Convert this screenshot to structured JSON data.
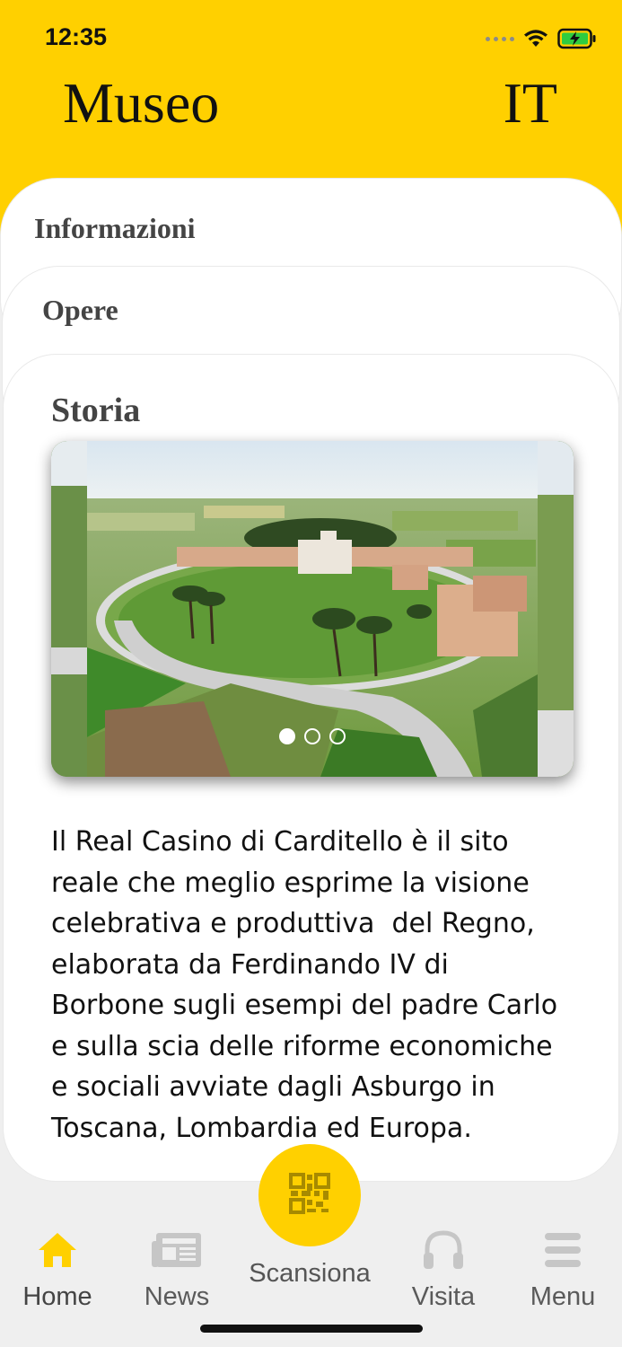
{
  "status_bar": {
    "time": "12:35"
  },
  "header": {
    "title": "Museo",
    "language": "IT"
  },
  "sections": {
    "info_title": "Informazioni",
    "opere_title": "Opere",
    "storia_title": "Storia"
  },
  "carousel": {
    "slide_count": 3,
    "active_index": 0
  },
  "story": {
    "text": "Il Real Casino di Carditello è il sito\nreale che meglio esprime la visione\ncelebrativa e produttiva  del Regno,\nelaborata da Ferdinando IV di\nBorbone sugli esempi del padre Carlo\ne sulla scia delle riforme economiche\ne sociali avviate dagli Asburgo in\nToscana, Lombardia ed Europa."
  },
  "tabbar": {
    "home": "Home",
    "news": "News",
    "scan": "Scansiona",
    "visita": "Visita",
    "menu": "Menu"
  },
  "colors": {
    "accent": "#ffd000",
    "background": "#efefef"
  }
}
